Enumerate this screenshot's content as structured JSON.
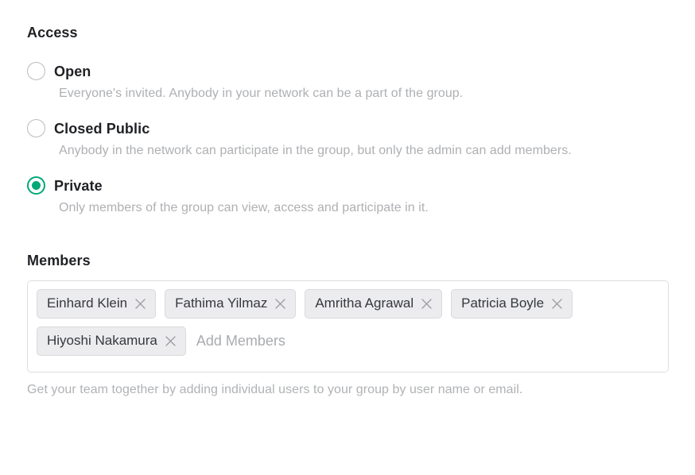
{
  "access": {
    "heading": "Access",
    "selected_value": "private",
    "options": [
      {
        "value": "open",
        "label": "Open",
        "description": "Everyone's invited. Anybody in your network can be a part of the group.",
        "selected": false
      },
      {
        "value": "closed_public",
        "label": "Closed Public",
        "description": "Anybody in the network can participate in the group, but only the admin can add members.",
        "selected": false
      },
      {
        "value": "private",
        "label": "Private",
        "description": "Only members of the group can view, access and participate in it.",
        "selected": true
      }
    ]
  },
  "members": {
    "heading": "Members",
    "chips": [
      {
        "name": "Einhard Klein",
        "remove_icon": "close-icon"
      },
      {
        "name": "Fathima Yilmaz",
        "remove_icon": "close-icon"
      },
      {
        "name": "Amritha Agrawal",
        "remove_icon": "close-icon"
      },
      {
        "name": "Patricia Boyle",
        "remove_icon": "close-icon"
      },
      {
        "name": "Hiyoshi Nakamura",
        "remove_icon": "close-icon"
      }
    ],
    "input_value": "",
    "input_placeholder": "Add Members",
    "help_text": "Get your team together by adding individual users to your group by user name or email."
  },
  "colors": {
    "accent_green": "#00a878",
    "heading_text": "#1f2124",
    "muted_text": "#aeb0b3",
    "chip_background": "#ececee",
    "chip_border": "#d9dadc",
    "box_border": "#dedede",
    "radio_ring": "#b9bbbd"
  }
}
